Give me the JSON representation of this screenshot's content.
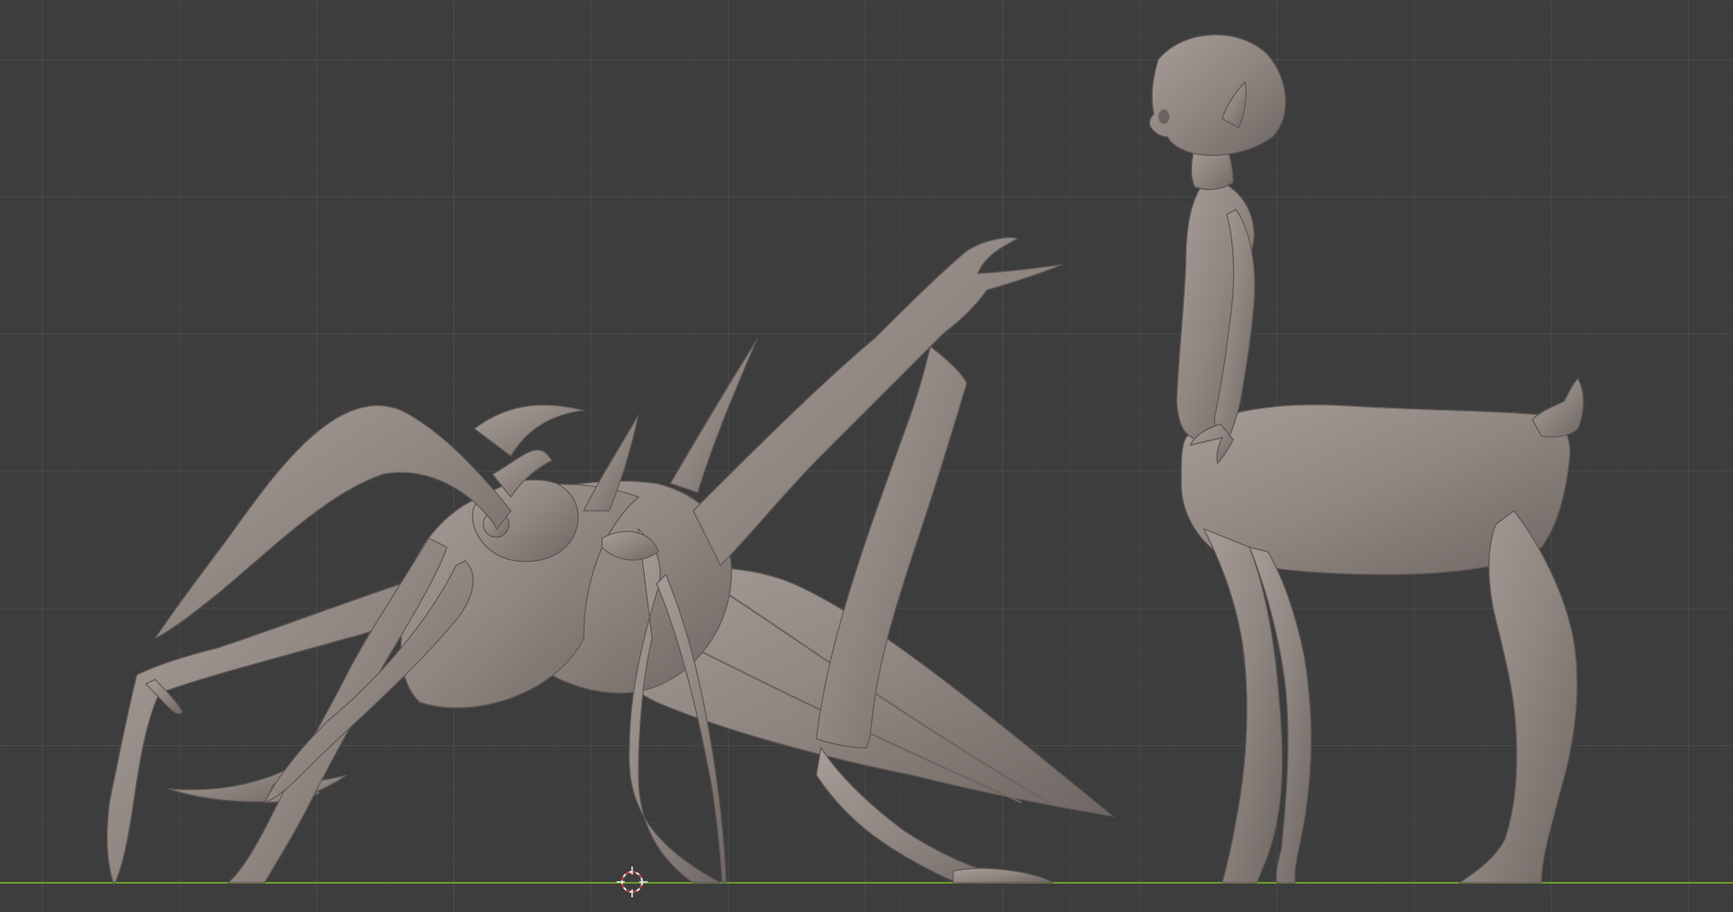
{
  "viewport": {
    "background": "#3d3d3d",
    "grid_major_color": "#4a4a4a",
    "grid_minor_color": "#424242",
    "ground_line_color": "#6a9a2a",
    "x_axis_color": "#d03838",
    "model_color": "#8e8580"
  },
  "objects": [
    {
      "name": "insect-creature-sculpt"
    },
    {
      "name": "centaur-girl-sculpt"
    }
  ],
  "gizmo": {
    "icon": "3d-cursor-icon"
  }
}
